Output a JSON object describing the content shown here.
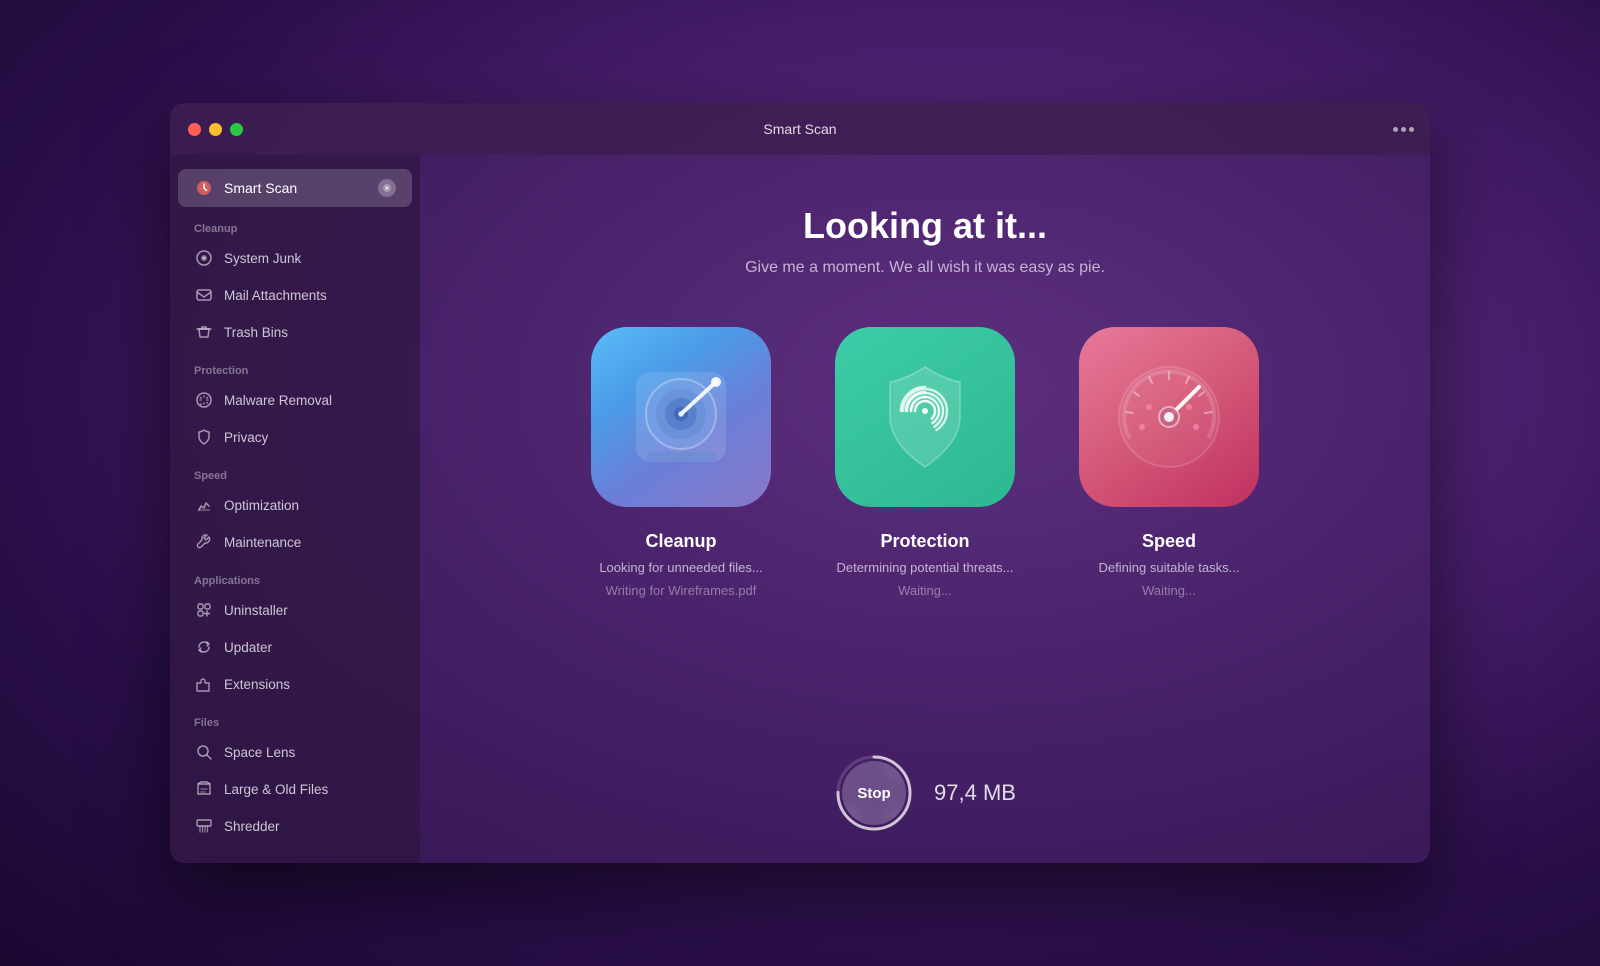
{
  "window": {
    "title": "Smart Scan"
  },
  "titlebar": {
    "title": "Smart Scan"
  },
  "sidebar": {
    "smart_scan_label": "Smart Scan",
    "cleanup_header": "Cleanup",
    "system_junk_label": "System Junk",
    "mail_attachments_label": "Mail Attachments",
    "trash_bins_label": "Trash Bins",
    "protection_header": "Protection",
    "malware_removal_label": "Malware Removal",
    "privacy_label": "Privacy",
    "speed_header": "Speed",
    "optimization_label": "Optimization",
    "maintenance_label": "Maintenance",
    "applications_header": "Applications",
    "uninstaller_label": "Uninstaller",
    "updater_label": "Updater",
    "extensions_label": "Extensions",
    "files_header": "Files",
    "space_lens_label": "Space Lens",
    "large_old_files_label": "Large & Old Files",
    "shredder_label": "Shredder"
  },
  "main": {
    "title": "Looking at it...",
    "subtitle": "Give me a moment. We all wish it was easy as pie.",
    "cleanup": {
      "title": "Cleanup",
      "status1": "Looking for unneeded files...",
      "status2": "Writing for Wireframes.pdf"
    },
    "protection": {
      "title": "Protection",
      "status1": "Determining potential threats...",
      "status2": "Waiting..."
    },
    "speed": {
      "title": "Speed",
      "status1": "Defining suitable tasks...",
      "status2": "Waiting..."
    },
    "stop_button_label": "Stop",
    "size_label": "97,4 MB"
  }
}
